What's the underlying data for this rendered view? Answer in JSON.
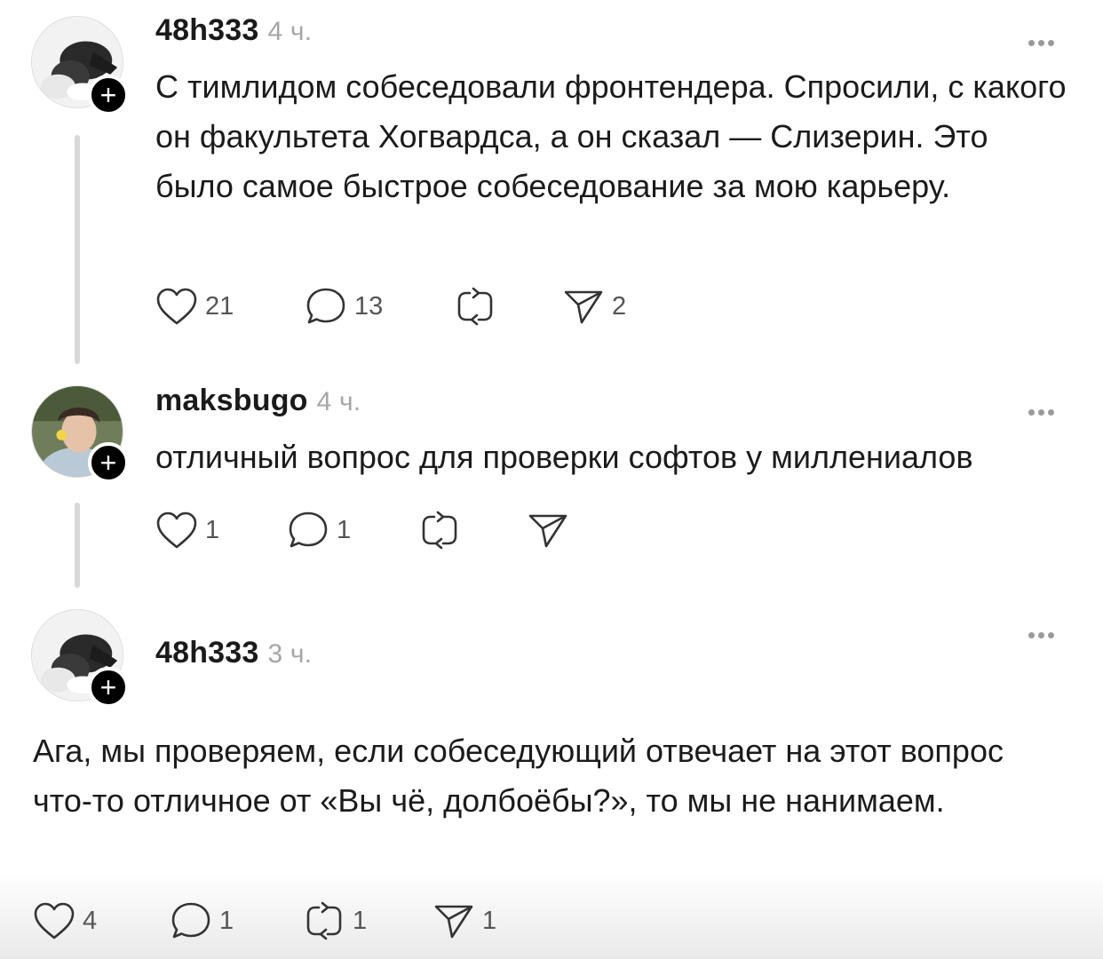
{
  "posts": [
    {
      "username": "48h333",
      "time": "4 ч.",
      "text": "С тимлидом собеседовали фронтендера. Спросили, с какого он факультета Хогвардса, а он сказал — Слизерин. Это было самое быстрое собеседование за мою карьеру.",
      "likes": "21",
      "comments": "13",
      "reposts": "",
      "shares": "2",
      "avatar_icon": "dog-avatar-icon"
    },
    {
      "username": "maksbugo",
      "time": "4 ч.",
      "text": "отличный вопрос для проверки софтов у миллениалов",
      "likes": "1",
      "comments": "1",
      "reposts": "",
      "shares": "",
      "avatar_icon": "person-avatar-icon"
    },
    {
      "username": "48h333",
      "time": "3 ч.",
      "text": "Ага, мы проверяем, если собеседующий отвечает на  этот вопрос что-то отличное от «Вы чё, долбоёбы?», то мы не нанимаем.",
      "likes": "4",
      "comments": "1",
      "reposts": "1",
      "shares": "1",
      "avatar_icon": "dog-avatar-icon"
    }
  ],
  "follow_symbol": "+",
  "colors": {
    "text": "#1b1b1b",
    "muted": "#a6a6a6",
    "thread_line": "#d8d8d8",
    "badge": "#000000"
  }
}
